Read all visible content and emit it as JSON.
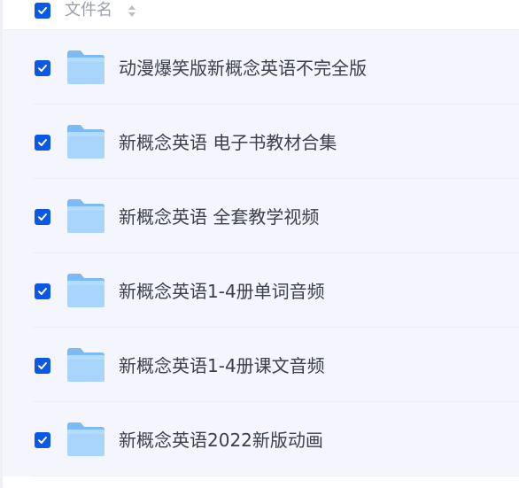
{
  "header": {
    "select_all_checked": true,
    "column_label": "文件名",
    "sort_icon": "sort-updown-icon"
  },
  "files": [
    {
      "name": "动漫爆笑版新概念英语不完全版",
      "checked": true,
      "icon": "folder-icon"
    },
    {
      "name": "新概念英语 电子书教材合集",
      "checked": true,
      "icon": "folder-icon"
    },
    {
      "name": "新概念英语 全套教学视频",
      "checked": true,
      "icon": "folder-icon"
    },
    {
      "name": "新概念英语1-4册单词音频",
      "checked": true,
      "icon": "folder-icon"
    },
    {
      "name": "新概念英语1-4册课文音频",
      "checked": true,
      "icon": "folder-icon"
    },
    {
      "name": "新概念英语2022新版动画",
      "checked": true,
      "icon": "folder-icon"
    }
  ],
  "colors": {
    "accent": "#0b57e6",
    "row_background": "#f5f6fd",
    "text": "#3b3f49",
    "header_text": "#9aa0ab",
    "folder_light": "#a9d4fb",
    "folder_dark": "#7cbaf5"
  }
}
